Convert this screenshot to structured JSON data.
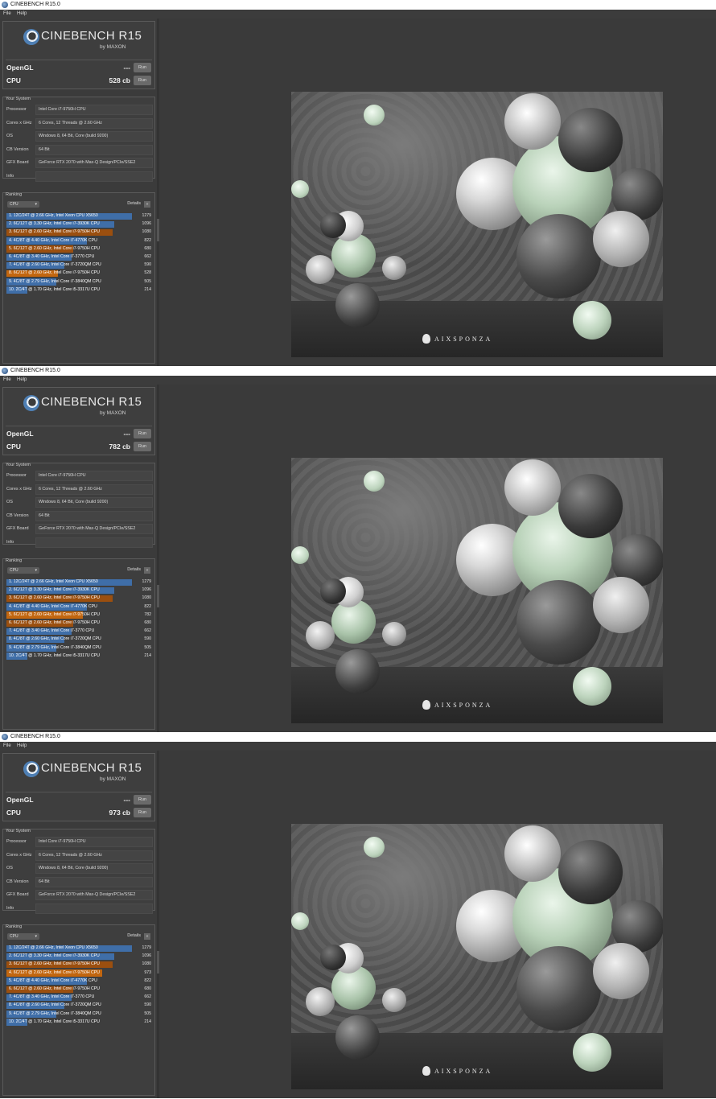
{
  "app": {
    "title": "CINEBENCH R15.0",
    "menu": [
      "File",
      "Help"
    ],
    "logo_text": "CINEBENCH R15",
    "logo_sub": "by MAXON",
    "opengl_label": "OpenGL",
    "cpu_label": "CPU",
    "run_label": "Run",
    "your_system_title": "Your System",
    "ranking_title": "Ranking",
    "ranking_dropdown": "CPU",
    "details_label": "Details",
    "details_btn": "»",
    "render_brand": "AIXSPONZA"
  },
  "system": [
    {
      "k": "Processor",
      "v": "Intel Core i7-9750H CPU"
    },
    {
      "k": "Cores x GHz",
      "v": "6 Cores, 12 Threads @ 2.60 GHz"
    },
    {
      "k": "OS",
      "v": "Windows 8, 64 Bit, Core (build 9200)"
    },
    {
      "k": "CB Version",
      "v": "64 Bit"
    },
    {
      "k": "GFX Board",
      "v": "GeForce RTX 2070 with Max-Q Design/PCIe/SSE2"
    },
    {
      "k": "Info",
      "v": ""
    }
  ],
  "colors": {
    "blue": "#3f6ea8",
    "orange": "#c2660f",
    "darkorange": "#9b4f0f"
  },
  "windows": [
    {
      "opengl_value": "---",
      "cpu_value": "528 cb",
      "ranking": [
        {
          "label": "1. 12C/24T @ 2.66 GHz, Intel Xeon CPU X5650",
          "score": "1279",
          "value": 1279,
          "color": "blue"
        },
        {
          "label": "2. 6C/12T @ 3.30 GHz,  Intel Core i7-3930K CPU",
          "score": "1096",
          "value": 1096,
          "color": "blue"
        },
        {
          "label": "3. 6C/12T @ 2.60 GHz, Intel Core i7-9750H CPU",
          "score": "1080",
          "value": 1080,
          "color": "darkorange"
        },
        {
          "label": "4. 4C/8T @ 4.40 GHz, Intel Core i7-4770K CPU",
          "score": "822",
          "value": 822,
          "color": "blue"
        },
        {
          "label": "5. 6C/12T @ 2.60 GHz, Intel Core i7-9750H CPU",
          "score": "680",
          "value": 680,
          "color": "darkorange"
        },
        {
          "label": "6. 4C/8T @ 3.40 GHz, Intel Core i7-3770 CPU",
          "score": "662",
          "value": 662,
          "color": "blue"
        },
        {
          "label": "7. 4C/8T @ 2.60 GHz, Intel Core i7-3720QM CPU",
          "score": "590",
          "value": 590,
          "color": "blue"
        },
        {
          "label": "8. 6C/12T @ 2.60 GHz, Intel Core i7-9750H CPU",
          "score": "528",
          "value": 528,
          "color": "orange"
        },
        {
          "label": "9. 4C/8T @ 2.79 GHz, Intel Core i7-3840QM CPU",
          "score": "505",
          "value": 505,
          "color": "blue"
        },
        {
          "label": "10. 2C/4T @ 1.70 GHz,  Intel Core i5-3317U CPU",
          "score": "214",
          "value": 214,
          "color": "blue"
        }
      ]
    },
    {
      "opengl_value": "---",
      "cpu_value": "782 cb",
      "ranking": [
        {
          "label": "1. 12C/24T @ 2.66 GHz, Intel Xeon CPU X5650",
          "score": "1279",
          "value": 1279,
          "color": "blue"
        },
        {
          "label": "2. 6C/12T @ 3.30 GHz,  Intel Core i7-3930K CPU",
          "score": "1096",
          "value": 1096,
          "color": "blue"
        },
        {
          "label": "3. 6C/12T @ 2.60 GHz, Intel Core i7-9750H CPU",
          "score": "1080",
          "value": 1080,
          "color": "darkorange"
        },
        {
          "label": "4. 4C/8T @ 4.40 GHz, Intel Core i7-4770K CPU",
          "score": "822",
          "value": 822,
          "color": "blue"
        },
        {
          "label": "5. 6C/12T @ 2.60 GHz, Intel Core i7-9750H CPU",
          "score": "782",
          "value": 782,
          "color": "orange"
        },
        {
          "label": "6. 6C/12T @ 2.60 GHz, Intel Core i7-9750H CPU",
          "score": "680",
          "value": 680,
          "color": "darkorange"
        },
        {
          "label": "7. 4C/8T @ 3.40 GHz, Intel Core i7-3770 CPU",
          "score": "662",
          "value": 662,
          "color": "blue"
        },
        {
          "label": "8. 4C/8T @ 2.60 GHz, Intel Core i7-3720QM CPU",
          "score": "590",
          "value": 590,
          "color": "blue"
        },
        {
          "label": "9. 4C/8T @ 2.79 GHz, Intel Core i7-3840QM CPU",
          "score": "505",
          "value": 505,
          "color": "blue"
        },
        {
          "label": "10. 2C/4T @ 1.70 GHz,  Intel Core i5-3317U CPU",
          "score": "214",
          "value": 214,
          "color": "blue"
        }
      ]
    },
    {
      "opengl_value": "---",
      "cpu_value": "973 cb",
      "ranking": [
        {
          "label": "1. 12C/24T @ 2.66 GHz, Intel Xeon CPU X5650",
          "score": "1279",
          "value": 1279,
          "color": "blue"
        },
        {
          "label": "2. 6C/12T @ 3.30 GHz,  Intel Core i7-3930K CPU",
          "score": "1096",
          "value": 1096,
          "color": "blue"
        },
        {
          "label": "3. 6C/12T @ 2.60 GHz, Intel Core i7-9750H CPU",
          "score": "1080",
          "value": 1080,
          "color": "darkorange"
        },
        {
          "label": "4. 6C/12T @ 2.60 GHz, Intel Core i7-9750H CPU",
          "score": "973",
          "value": 973,
          "color": "orange"
        },
        {
          "label": "5. 4C/8T @ 4.40 GHz, Intel Core i7-4770K CPU",
          "score": "822",
          "value": 822,
          "color": "blue"
        },
        {
          "label": "6. 6C/12T @ 2.60 GHz, Intel Core i7-9750H CPU",
          "score": "680",
          "value": 680,
          "color": "darkorange"
        },
        {
          "label": "7. 4C/8T @ 3.40 GHz, Intel Core i7-3770 CPU",
          "score": "662",
          "value": 662,
          "color": "blue"
        },
        {
          "label": "8. 4C/8T @ 2.60 GHz, Intel Core i7-3720QM CPU",
          "score": "590",
          "value": 590,
          "color": "blue"
        },
        {
          "label": "9. 4C/8T @ 2.79 GHz, Intel Core i7-3840QM CPU",
          "score": "505",
          "value": 505,
          "color": "blue"
        },
        {
          "label": "10. 2C/4T @ 1.70 GHz,  Intel Core i5-3317U CPU",
          "score": "214",
          "value": 214,
          "color": "blue"
        }
      ]
    }
  ]
}
